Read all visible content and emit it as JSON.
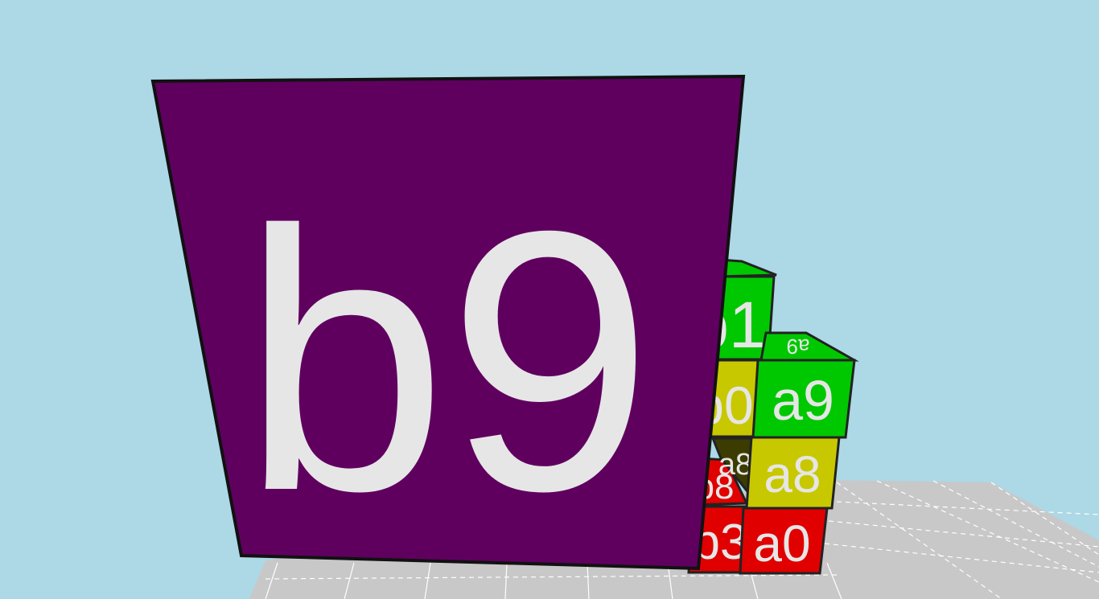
{
  "colors": {
    "sky": "#add8e6",
    "floor": "#c8c8c8",
    "red": "#e00000",
    "yellow": "#c8c800",
    "green": "#00c800",
    "purple": "#5f005f",
    "label": "#e6e6e6"
  },
  "blocks": {
    "big_front": {
      "label": "b9",
      "color": "purple"
    },
    "a9_front": {
      "label": "a9",
      "color": "green"
    },
    "a9_top": {
      "label": "a9",
      "color": "green"
    },
    "a8_front": {
      "label": "a8",
      "color": "yellow"
    },
    "a8_side": {
      "label": "a8",
      "color": "yellow"
    },
    "a0_front": {
      "label": "a0",
      "color": "red"
    },
    "b1_front": {
      "label": "b1",
      "color": "green"
    },
    "b0_front": {
      "label": "b0",
      "color": "yellow"
    },
    "b3_front": {
      "label": "b3",
      "color": "red"
    },
    "b8_top": {
      "label": "b8",
      "color": "red"
    }
  }
}
